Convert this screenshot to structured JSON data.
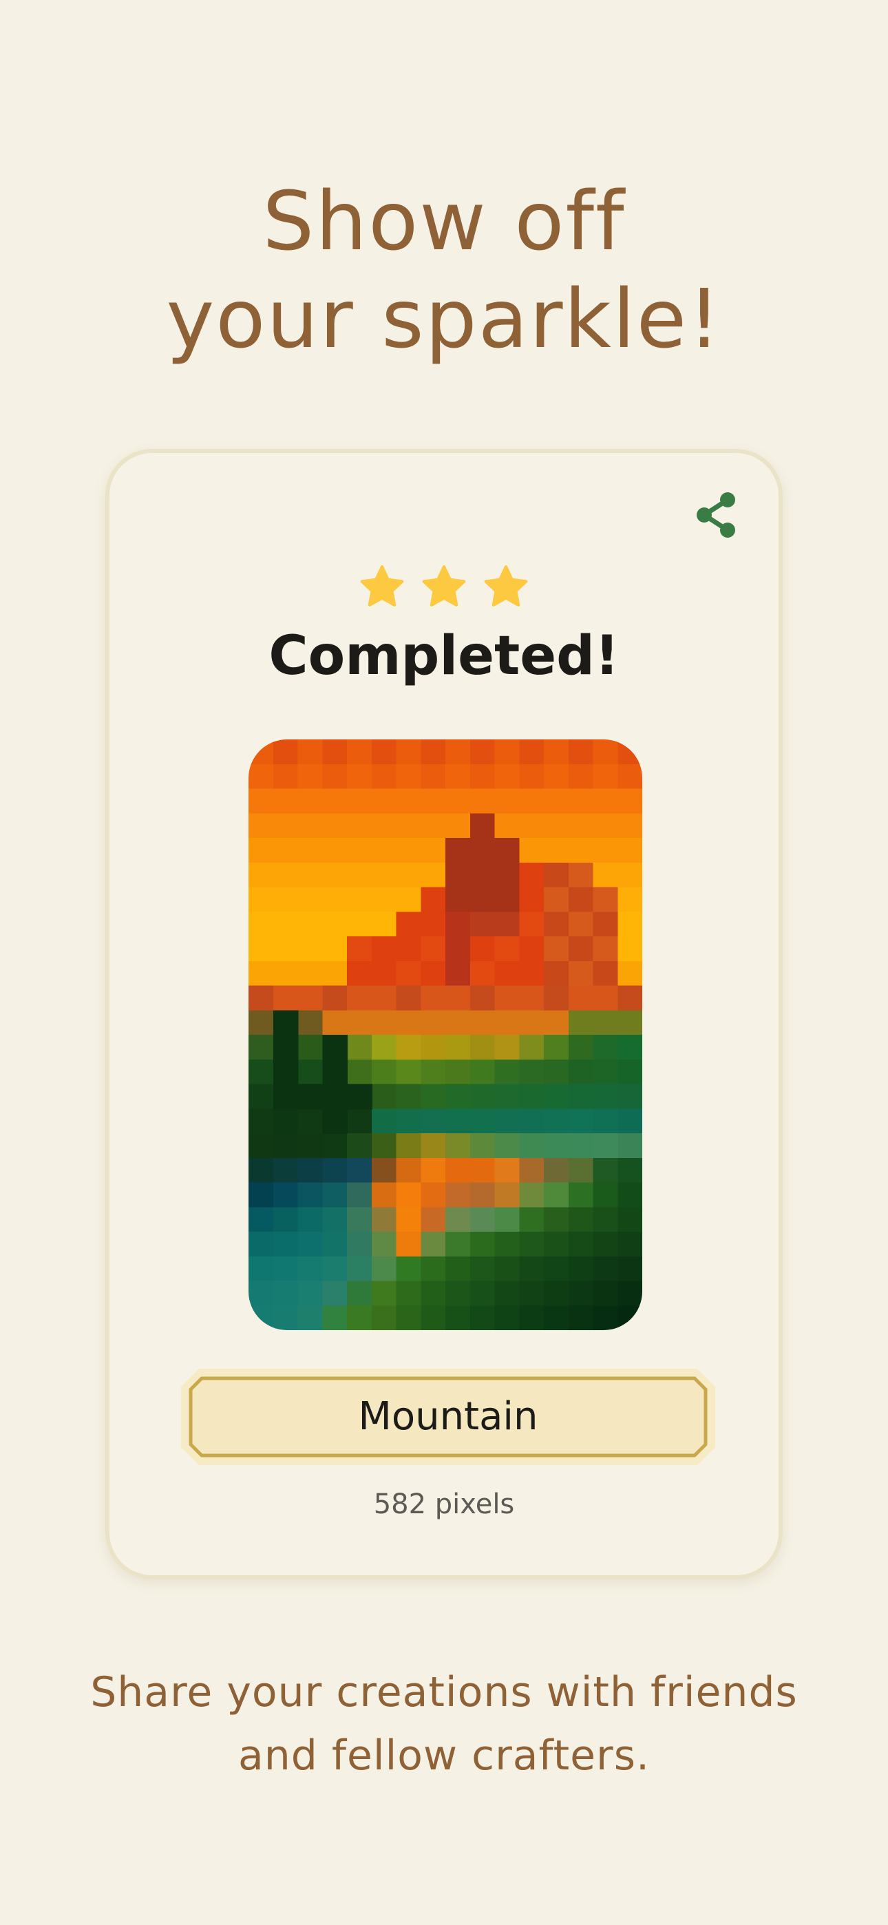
{
  "headline": {
    "line1": "Show off",
    "line2": "your sparkle!"
  },
  "card": {
    "share_icon": "share-icon",
    "rating": {
      "stars_earned": 3,
      "stars_total": 3
    },
    "status": "Completed!",
    "artwork": {
      "title": "Mountain",
      "pixel_count": "582 pixels"
    }
  },
  "caption": {
    "line1": "Share your creations with friends",
    "line2": "and fellow crafters."
  },
  "colors": {
    "background": "#f5f1e4",
    "headline": "#8f6137",
    "share_icon": "#3a7d44",
    "star": "#fcc940",
    "plaque_fill": "#f5e8c1",
    "plaque_border": "#c9a84c"
  }
}
